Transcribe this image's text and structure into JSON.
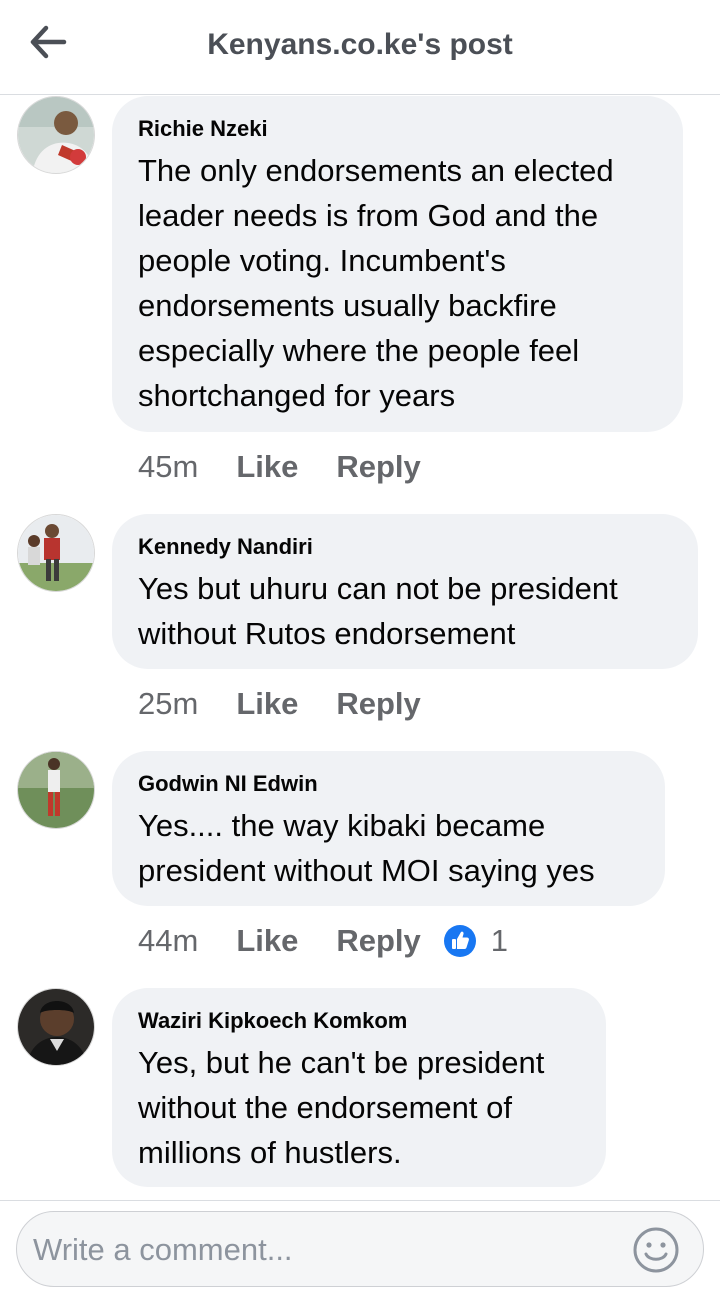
{
  "header": {
    "title": "Kenyans.co.ke's post"
  },
  "comments": [
    {
      "author": "Richie Nzeki",
      "text": "The only endorsements an elected leader needs is from God and the people voting. Incumbent's endorsements usually backfire especially where the people feel shortchanged for years",
      "time": "45m",
      "like_label": "Like",
      "reply_label": "Reply"
    },
    {
      "author": "Kennedy Nandiri",
      "text": "Yes but  uhuru can not be president without Rutos endorsement",
      "time": "25m",
      "like_label": "Like",
      "reply_label": "Reply"
    },
    {
      "author": "Godwin NI Edwin",
      "text": "Yes.... the way kibaki became president without MOI saying yes",
      "time": "44m",
      "like_label": "Like",
      "reply_label": "Reply",
      "reactions": "1"
    },
    {
      "author": "Waziri Kipkoech Komkom",
      "text": "Yes, but he can't be president without the endorsement of millions of hustlers."
    }
  ],
  "composer": {
    "placeholder": "Write a comment..."
  },
  "colors": {
    "bubble": "#f0f2f5",
    "like_blue": "#1877f2",
    "secondary_text": "#65676b"
  },
  "icons": {
    "back": "arrow-left-icon",
    "reaction": "thumbs-up-icon",
    "emoji": "smiley-icon"
  }
}
